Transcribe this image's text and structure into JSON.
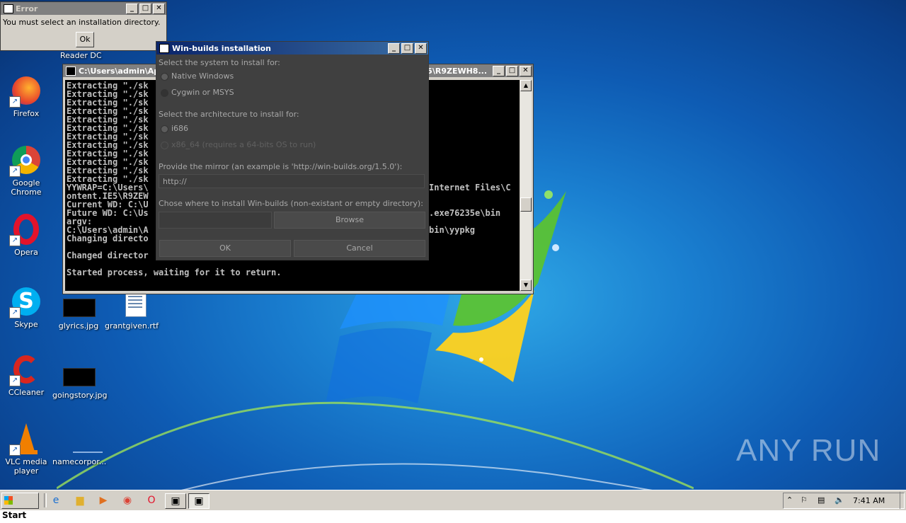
{
  "error_dialog": {
    "title": "Error",
    "message": "You must select an installation directory.",
    "ok_label": "Ok"
  },
  "partial_icon_label": "Reader DC",
  "desktop_icons": [
    {
      "label": "Firefox"
    },
    {
      "label": "Google Chrome"
    },
    {
      "label": "Opera"
    },
    {
      "label": "Skype"
    },
    {
      "label": "CCleaner"
    },
    {
      "label": "VLC media player"
    },
    {
      "label": "glyrics.jpg"
    },
    {
      "label": "grantgiven.rtf"
    },
    {
      "label": "goingstory.jpg"
    },
    {
      "label": "namecorpor..."
    }
  ],
  "cmd_window": {
    "title": "C:\\Users\\admin\\Ap",
    "title_right": "IE5\\R9ZEWH8...",
    "lines_left": [
      "Extracting \"./sk",
      "Extracting \"./sk",
      "Extracting \"./sk",
      "Extracting \"./sk",
      "Extracting \"./sk",
      "Extracting \"./sk",
      "Extracting \"./sk",
      "Extracting \"./sk",
      "Extracting \"./sk",
      "Extracting \"./sk",
      "Extracting \"./sk",
      "Extracting \"./sk",
      "YYWRAP=C:\\Users\\",
      "ontent.IE5\\R9ZEW",
      "Current WD: C:\\U",
      "Future WD: C:\\Us",
      "argv:",
      "C:\\Users\\admin\\A",
      "Changing directo",
      "",
      "Changed director",
      "",
      "Started process, waiting for it to return."
    ],
    "lines_right": [
      {
        "text": "Internet Files\\C",
        "row": 12
      },
      {
        "text": ".exe76235e\\bin",
        "row": 15
      },
      {
        "text": "bin\\yypkg",
        "row": 17
      }
    ]
  },
  "installer": {
    "title": "Win-builds installation",
    "system_label": "Select the system to install for:",
    "system_options": [
      "Native Windows",
      "Cygwin or MSYS"
    ],
    "arch_label": "Select the architecture to install for:",
    "arch_options": [
      "i686",
      "x86_64 (requires a 64-bits OS to run)"
    ],
    "mirror_label": "Provide the mirror (an example is 'http://win-builds.org/1.5.0'):",
    "mirror_value": "http://",
    "dir_label": "Chose where to install Win-builds (non-existant or empty directory):",
    "dir_value": "",
    "browse_label": "Browse",
    "ok_label": "OK",
    "cancel_label": "Cancel"
  },
  "taskbar": {
    "start_label": "Start",
    "clock": "7:41 AM"
  },
  "watermark": "ANY RUN"
}
